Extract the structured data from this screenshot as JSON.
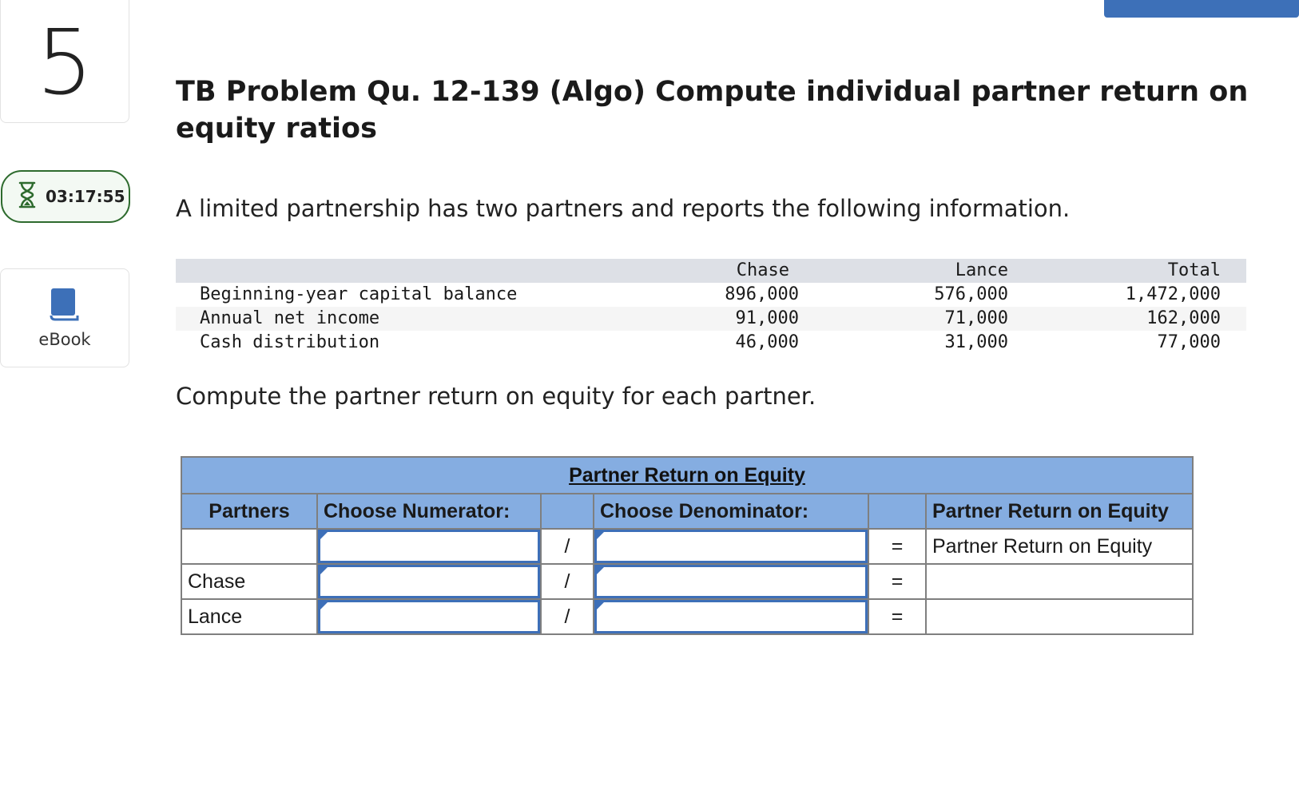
{
  "sidebar": {
    "question_number": "5",
    "timer": "03:17:55",
    "ebook_label": "eBook"
  },
  "question": {
    "title": "TB Problem Qu. 12-139 (Algo) Compute individual partner return on equity ratios",
    "intro": "A limited partnership has two partners and reports the following information.",
    "prompt": "Compute the partner return on equity for each partner."
  },
  "info_table": {
    "headers": [
      "Chase",
      "Lance",
      "Total"
    ],
    "rows": [
      {
        "label": "Beginning-year capital balance",
        "values": [
          "896,000",
          "576,000",
          "1,472,000"
        ]
      },
      {
        "label": "Annual net income",
        "values": [
          "91,000",
          "71,000",
          "162,000"
        ]
      },
      {
        "label": "Cash distribution",
        "values": [
          "46,000",
          "31,000",
          "77,000"
        ]
      }
    ]
  },
  "answer_table": {
    "title": "Partner Return on Equity",
    "headers": {
      "partners": "Partners",
      "numerator": "Choose Numerator:",
      "denominator": "Choose Denominator:",
      "result": "Partner Return on Equity"
    },
    "divide_symbol": "/",
    "equals_symbol": "=",
    "rows": [
      {
        "partner": "",
        "result": "Partner Return on Equity"
      },
      {
        "partner": "Chase",
        "result": ""
      },
      {
        "partner": "Lance",
        "result": ""
      }
    ]
  },
  "colors": {
    "accent": "#3d70b8",
    "table_header": "#85ade1",
    "timer_border": "#2e6b2e"
  }
}
